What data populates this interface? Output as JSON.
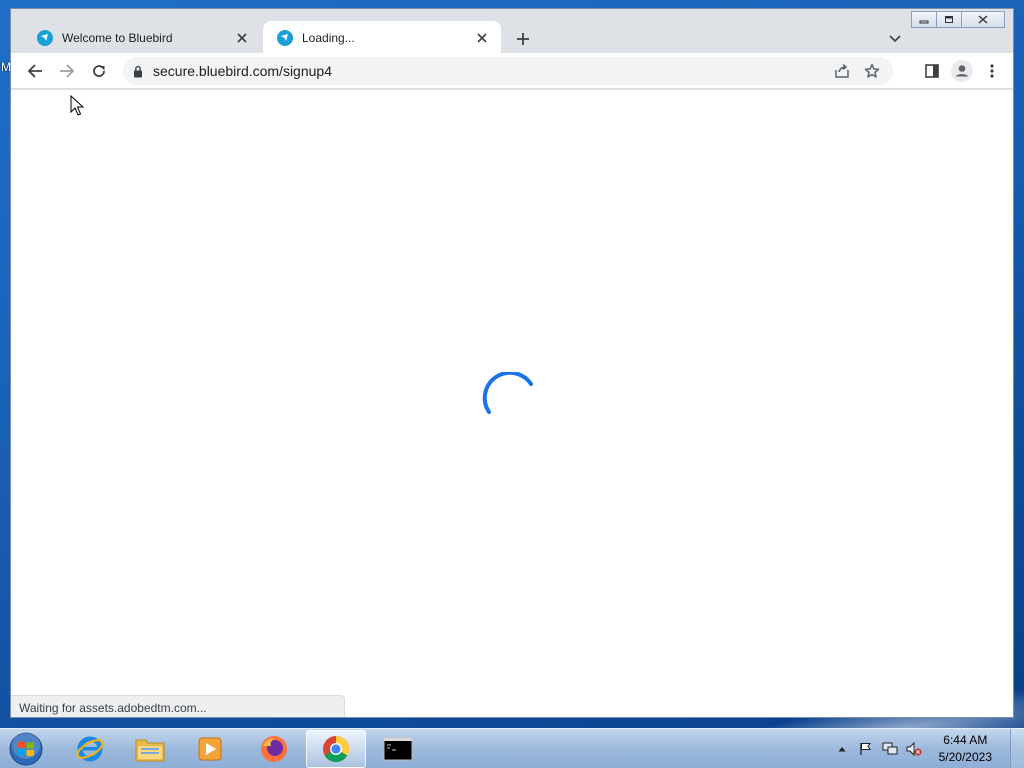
{
  "desktop": {
    "edge_letter": "M"
  },
  "browser": {
    "tabs": [
      {
        "title": "Welcome to Bluebird",
        "active": false
      },
      {
        "title": "Loading...",
        "active": true
      }
    ],
    "address": {
      "url": "secure.bluebird.com/signup4"
    },
    "status_text": "Waiting for assets.adobedtm.com...",
    "accent_color": "#1a73e8"
  },
  "taskbar": {
    "apps": [
      "internet-explorer",
      "file-explorer",
      "media-player",
      "firefox",
      "chrome",
      "command-prompt"
    ],
    "clock": {
      "time": "6:44 AM",
      "date": "5/20/2023"
    }
  }
}
